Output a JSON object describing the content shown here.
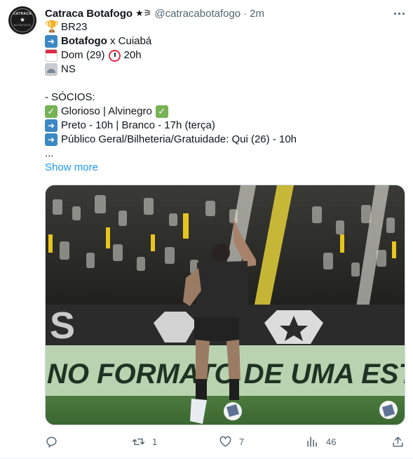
{
  "author": {
    "name": "Catraca Botafogo",
    "name_emoji": "★⚞",
    "handle": "@catracabotafogo",
    "separator": "·",
    "time": "2m",
    "avatar_text_top": "CATRACA",
    "avatar_text_bottom": "BOTAFOGO"
  },
  "tweet": {
    "line1": "BR23",
    "line2_bold": "Botafogo",
    "line2_rest": " x Cuiabá",
    "line3_a": "Dom (29)",
    "line3_b": "20h",
    "line4": "NS",
    "line6": "- SÓCIOS:",
    "line7": "Glorioso | Alvinegro",
    "line8": "Preto - 10h | Branco - 17h (terça)",
    "line9": "Público Geral/Bilheteria/Gratuidade: Qui (26) - 10h",
    "line10": "...",
    "show_more": "Show more"
  },
  "media": {
    "banner_text": "NO FORMATO DE UMA ESTR"
  },
  "actions": {
    "reply_count": "",
    "retweet_count": "1",
    "like_count": "7",
    "views_count": "46"
  },
  "icons": {
    "line1": "trophy-icon",
    "line2": "right-arrow-icon",
    "line3a": "calendar-icon",
    "line3b": "alarm-clock-icon",
    "line4": "stadium-icon",
    "check": "check-mark-icon"
  },
  "colors": {
    "text": "#0f1419",
    "muted": "#536471",
    "link": "#1d9bf0",
    "arrow_emoji": "#3b88c3",
    "check_emoji": "#77b255"
  }
}
